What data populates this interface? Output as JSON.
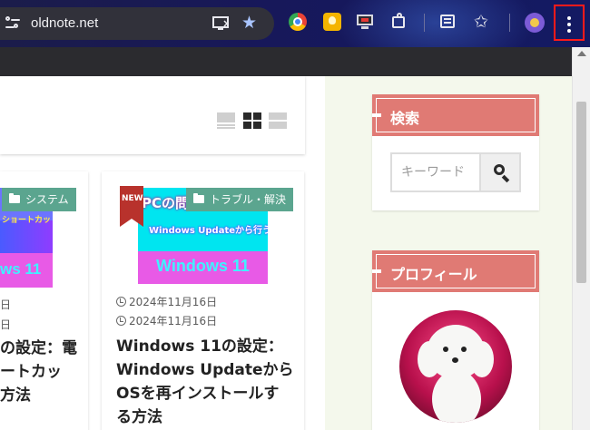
{
  "browser": {
    "url": "oldnote.net",
    "menu_button_highlight_color": "#ff1a1a",
    "icons": [
      "site-info-icon",
      "cast-icon",
      "bookmark-star-icon",
      "chrome-extension-icon",
      "bulb-extension-icon",
      "monitor-extension-icon",
      "extensions-puzzle-icon",
      "reading-list-icon",
      "bookmarks-star-icon",
      "profile-avatar-icon",
      "menu-kebab-icon"
    ]
  },
  "main": {
    "view_toggle": [
      "list-view-icon",
      "grid-view-icon",
      "wide-view-icon"
    ],
    "articles": [
      {
        "category": "システム",
        "thumb_line1": "ショートカット",
        "thumb_line2": "ws 11",
        "date_published": "日",
        "date_updated": "日",
        "title": "の設定：電\nートカッ\n方法"
      },
      {
        "new_badge": "NEW",
        "category": "トラブル・解決",
        "thumb_line1": "PCの問",
        "thumb_line2": "Windows Updateから行う",
        "thumb_line3": "Windows 11",
        "date_published": "2024年11月16日",
        "date_updated": "2024年11月16日",
        "title": "Windows 11の設定：\nWindows Updateから\nOSを再インストールす\nる方法"
      }
    ]
  },
  "sidebar": {
    "search": {
      "heading": "検索",
      "placeholder": "キーワード"
    },
    "profile": {
      "heading": "プロフィール"
    },
    "accent_color": "#e07a74"
  }
}
